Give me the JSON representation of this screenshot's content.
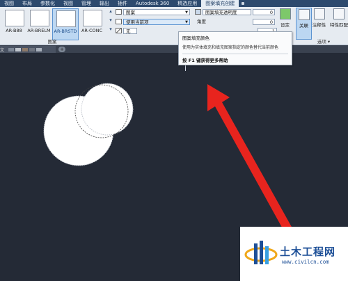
{
  "menu_tabs": [
    "视图",
    "布局",
    "参数化",
    "视图",
    "管理",
    "输出",
    "插件",
    "Autodesk 360",
    "精选应用",
    "图案填充创建"
  ],
  "active_tab_index": 9,
  "patterns": [
    {
      "label": "AR-B88"
    },
    {
      "label": "AR-BRELM"
    },
    {
      "label": "AR-BRSTD",
      "selected": true
    },
    {
      "label": "AR-CONC"
    }
  ],
  "pattern_panel_label": "图案",
  "props": {
    "type_value": "图案",
    "color_value": "使用当前项",
    "bg_value": "无",
    "transparency_label": "图案填充透明度",
    "transparency_value": "0",
    "angle_label": "角度",
    "angle_value": "0",
    "scale_value": "1"
  },
  "buttons": {
    "origin": "设定",
    "associative": "关联",
    "annotative": "注释性",
    "match": "特性匹配"
  },
  "options_panel_label": "选项 ▾",
  "tooltip": {
    "title": "图案填充颜色",
    "description": "使用为实体填充和填充图案指定的颜色替代当前颜色",
    "help": "按 F1 键获得更多帮助"
  },
  "file_tab": "文",
  "new_tab_symbol": "+",
  "watermark": {
    "brand": "土木工程网",
    "url": "www.civilcn.com"
  },
  "colors": {
    "canvas": "#242a36",
    "ribbon": "#e6ebf1",
    "arrow": "#e8241e",
    "accent": "#2d4a6e"
  }
}
